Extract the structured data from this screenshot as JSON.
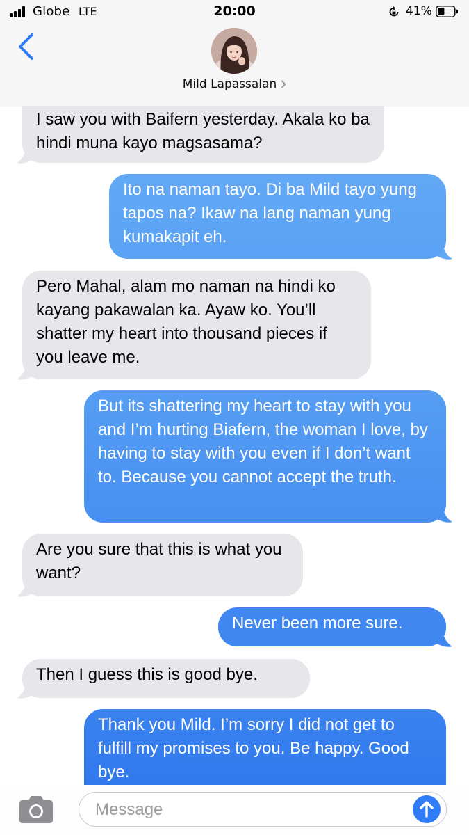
{
  "status_bar": {
    "carrier": "Globe",
    "network": "LTE",
    "time": "20:00",
    "battery_percent": "41%",
    "battery_level": 0.41
  },
  "header": {
    "contact_name": "Mild Lapassalan",
    "back_icon": "chevron-left-icon",
    "details_icon": "chevron-right-icon"
  },
  "messages": [
    {
      "from": "contact",
      "text": "I saw you with Baifern yesterday. Akala ko ba hindi muna kayo magsasama?"
    },
    {
      "from": "me",
      "text": "Ito na naman tayo. Di ba Mild tayo yung tapos na? Ikaw na lang naman yung kumakapit eh."
    },
    {
      "from": "contact",
      "text": "Pero Mahal, alam mo naman na hindi ko kayang pakawalan ka. Ayaw ko. You’ll shatter my heart into thousand pieces if you leave me."
    },
    {
      "from": "me",
      "text": "But its shattering my heart to stay with you and I’m hurting Biafern, the woman I love, by having to stay with you even if I don’t want to. Because you cannot accept the truth."
    },
    {
      "from": "contact",
      "text": "Are you sure that this is what you want?"
    },
    {
      "from": "me",
      "text": "Never been more sure."
    },
    {
      "from": "contact",
      "text": "Then I guess this is good bye."
    },
    {
      "from": "me",
      "text": "Thank you Mild. I’m sorry I did not get to fulfill my promises to you. Be happy. Good bye."
    }
  ],
  "input": {
    "placeholder": "Message",
    "value": "",
    "camera_icon": "camera-icon",
    "send_icon": "arrow-up-icon"
  },
  "colors": {
    "incoming_bubble": "#e7e7eb",
    "outgoing_top": "#62aaf5",
    "outgoing_bottom": "#2a72eb",
    "accent": "#2f7cf6"
  }
}
